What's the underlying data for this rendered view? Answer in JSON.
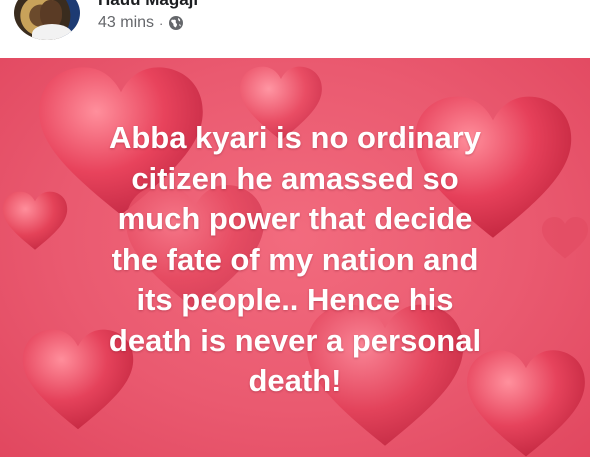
{
  "post": {
    "author_name": "Hauu Magaji",
    "time": "43 mins",
    "separator": "·",
    "privacy_icon": "globe-icon",
    "text": "Abba kyari is no ordinary\ncitizen he amassed so\nmuch power that decide\nthe fate of my nation and\nits people.. Hence his\ndeath is never a personal\ndeath!"
  },
  "colors": {
    "background_pink": "#ea5a70",
    "heart_red": "#e03a55",
    "text_white": "#ffffff",
    "meta_grey": "#65676b"
  }
}
